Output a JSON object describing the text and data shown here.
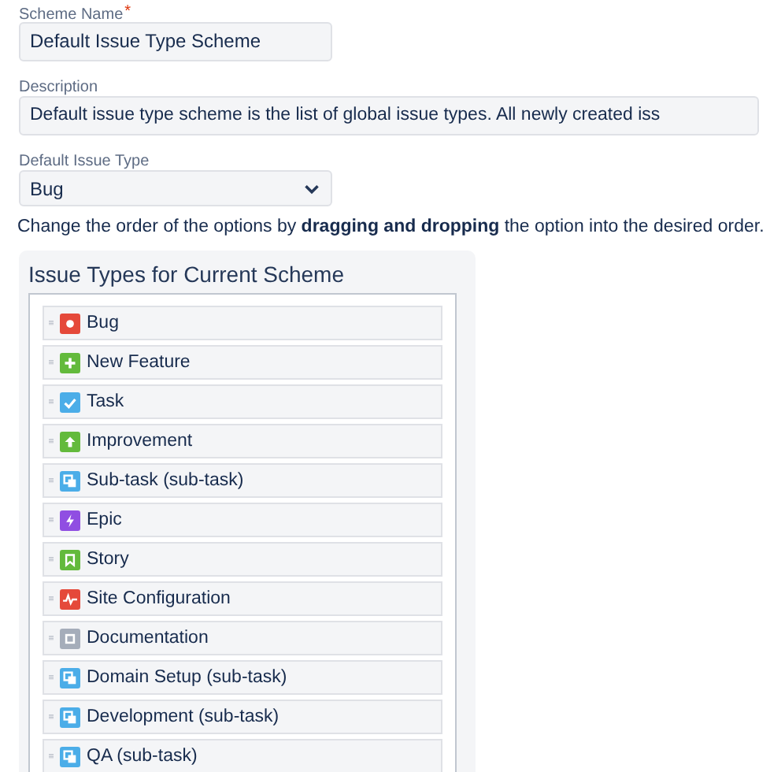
{
  "scheme_name": {
    "label": "Scheme Name",
    "required_mark": "*",
    "value": "Default Issue Type Scheme"
  },
  "description": {
    "label": "Description",
    "value": "Default issue type scheme is the list of global issue types. All newly created iss"
  },
  "default_issue_type": {
    "label": "Default Issue Type",
    "value": "Bug"
  },
  "help_text": "Change the order of the options by **dragging and dropping** the option into the desired order.",
  "issue_types_panel": {
    "title": "Issue Types for Current Scheme",
    "items": [
      {
        "label": "Bug",
        "kind": "bug",
        "color": "#e5493a"
      },
      {
        "label": "New Feature",
        "kind": "plus",
        "color": "#63ba3c"
      },
      {
        "label": "Task",
        "kind": "check",
        "color": "#4bade8"
      },
      {
        "label": "Improvement",
        "kind": "arrow-up",
        "color": "#63ba3c"
      },
      {
        "label": "Sub-task (sub-task)",
        "kind": "subtask",
        "color": "#4bade8"
      },
      {
        "label": "Epic",
        "kind": "bolt",
        "color": "#904ee2"
      },
      {
        "label": "Story",
        "kind": "bookmark",
        "color": "#63ba3c"
      },
      {
        "label": "Site Configuration",
        "kind": "pulse",
        "color": "#e5493a"
      },
      {
        "label": "Documentation",
        "kind": "square",
        "color": "#a5adba"
      },
      {
        "label": "Domain Setup (sub-task)",
        "kind": "subtask",
        "color": "#4bade8"
      },
      {
        "label": "Development (sub-task)",
        "kind": "subtask",
        "color": "#4bade8"
      },
      {
        "label": "QA (sub-task)",
        "kind": "subtask",
        "color": "#4bade8"
      }
    ]
  }
}
